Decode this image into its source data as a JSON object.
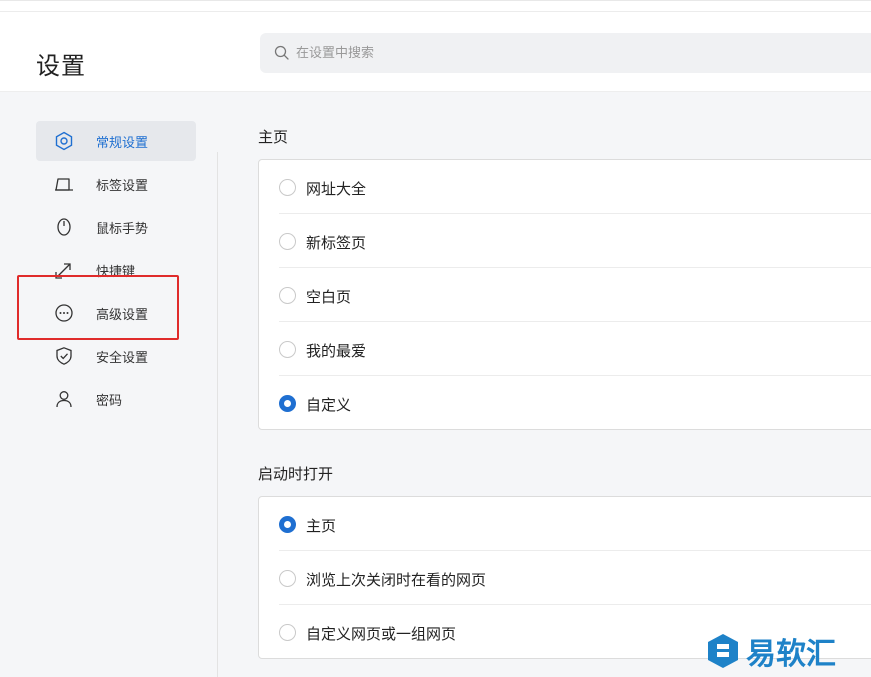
{
  "header": {
    "title": "设置",
    "search": {
      "placeholder": "在设置中搜索",
      "value": ""
    }
  },
  "sidebar": {
    "items": [
      {
        "label": "常规设置",
        "icon": "hexagon-settings-icon",
        "active": true
      },
      {
        "label": "标签设置",
        "icon": "tab-icon",
        "active": false
      },
      {
        "label": "鼠标手势",
        "icon": "mouse-icon",
        "active": false
      },
      {
        "label": "快捷键",
        "icon": "shortcut-arrow-icon",
        "active": false
      },
      {
        "label": "高级设置",
        "icon": "more-circle-icon",
        "active": false
      },
      {
        "label": "安全设置",
        "icon": "shield-check-icon",
        "active": false
      },
      {
        "label": "密码",
        "icon": "user-icon",
        "active": false
      }
    ]
  },
  "homepage": {
    "title": "主页",
    "options": [
      {
        "label": "网址大全",
        "checked": false
      },
      {
        "label": "新标签页",
        "checked": false
      },
      {
        "label": "空白页",
        "checked": false
      },
      {
        "label": "我的最爱",
        "checked": false
      },
      {
        "label": "自定义",
        "checked": true
      }
    ]
  },
  "startup": {
    "title": "启动时打开",
    "options": [
      {
        "label": "主页",
        "checked": true
      },
      {
        "label": "浏览上次关闭时在看的网页",
        "checked": false
      },
      {
        "label": "自定义网页或一组网页",
        "checked": false
      }
    ]
  },
  "watermark": {
    "text": "易软汇"
  },
  "colors": {
    "accent": "#1f6fd1",
    "highlight": "#e02b2b",
    "watermark": "#1e82c8"
  }
}
